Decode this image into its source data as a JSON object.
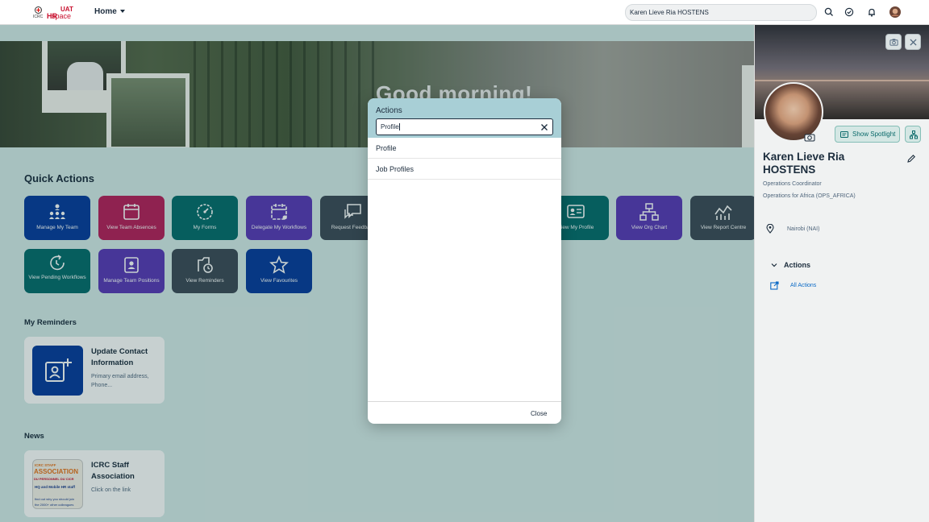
{
  "shell": {
    "logo_small": "ICRC",
    "logo_hr": "HR",
    "logo_uat": "UAT",
    "logo_space": "space",
    "home_label": "Home",
    "search_value": "Karen Lieve Ria HOSTENS"
  },
  "banner": {
    "greeting": "Good morning!"
  },
  "quick_actions": {
    "title": "Quick Actions",
    "tiles": [
      {
        "label": "Manage My Team",
        "color": "#0a3d9e",
        "icon": "org-team-icon"
      },
      {
        "label": "View Team Absences",
        "color": "#b8205b",
        "icon": "calendar-icon"
      },
      {
        "label": "My Forms",
        "color": "#086d6d",
        "icon": "gauge-icon"
      },
      {
        "label": "Delegate My Workflows",
        "color": "#5b3ab8",
        "icon": "calendar-delegate-icon"
      },
      {
        "label": "Request Feedback",
        "color": "#3f4c59",
        "icon": "feedback-icon"
      },
      {
        "label": "View My Profile",
        "color": "#086d6d",
        "icon": "id-card-icon"
      },
      {
        "label": "View Org Chart",
        "color": "#5b3ab8",
        "icon": "org-chart-icon"
      },
      {
        "label": "View Report Centre",
        "color": "#3f4c59",
        "icon": "line-chart-icon"
      },
      {
        "label": "View Pending Workflows",
        "color": "#086d6d",
        "icon": "pending-icon"
      },
      {
        "label": "Manage Team Positions",
        "color": "#5b3ab8",
        "icon": "position-icon"
      },
      {
        "label": "View Reminders",
        "color": "#3f4c59",
        "icon": "reminder-icon"
      },
      {
        "label": "View Favourites",
        "color": "#0a3d9e",
        "icon": "star-icon"
      }
    ]
  },
  "reminders": {
    "title": "My Reminders",
    "card_title": "Update Contact Information",
    "card_sub": "Primary email address, Phone..."
  },
  "news": {
    "title": "News",
    "card_title": "ICRC Staff Association",
    "card_sub": "Click on the link",
    "thumb_line1": "ICRC STAFF",
    "thumb_line2": "ASSOCIATION",
    "thumb_line3": "DU PERSONNEL DU CICR",
    "thumb_line4": "HQ and Mobile HR staff",
    "thumb_line5": "find out why you should join",
    "thumb_line6": "the 2000+ other colleagues"
  },
  "profile_panel": {
    "spotlight_label": "Show Spotlight",
    "name": "Karen Lieve Ria HOSTENS",
    "job_title": "Operations Coordinator",
    "department": "Operations for Africa (OPS_AFRICA)",
    "location": "Nairobi (NAI)",
    "actions_header": "Actions",
    "all_actions_label": "All Actions"
  },
  "dialog": {
    "title": "Actions",
    "search_value": "Profile",
    "results": [
      "Profile",
      "Job Profiles"
    ],
    "close_label": "Close"
  },
  "colors": {
    "page_bg": "#d7ecea",
    "dialog_header": "#a8cfd6",
    "link": "#0a6ed1"
  }
}
